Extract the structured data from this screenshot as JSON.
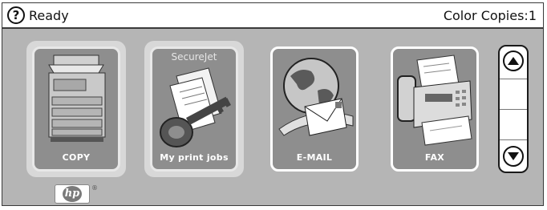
{
  "status": {
    "help_glyph": "?",
    "state": "Ready",
    "copies": "Color Copies:1"
  },
  "tiles": [
    {
      "label": "COPY"
    },
    {
      "label": "My print jobs",
      "header": "SecureJet"
    },
    {
      "label": "E-MAIL"
    },
    {
      "label": "FAX"
    }
  ],
  "scroll": {
    "up_icon": "arrow-up-icon",
    "down_icon": "arrow-down-icon"
  },
  "branding": {
    "logo": "hp",
    "registered": "®"
  }
}
